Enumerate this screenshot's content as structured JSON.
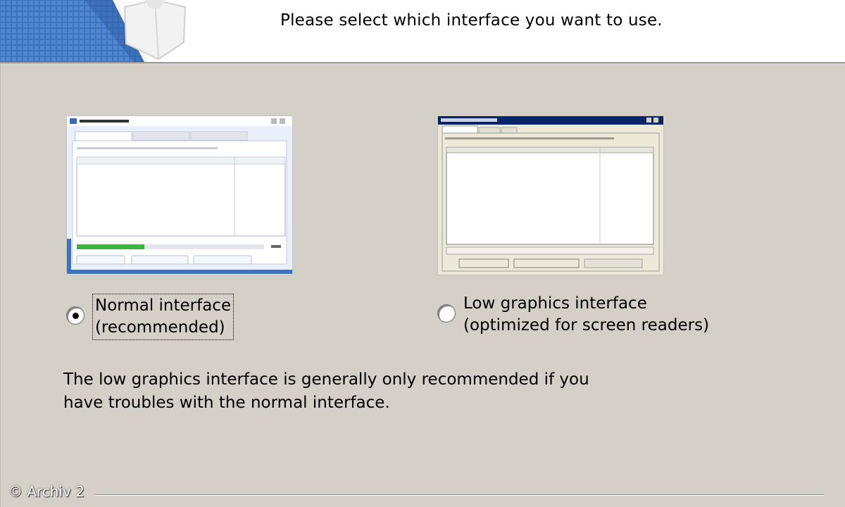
{
  "header": {
    "title": "Please select which interface you want to use."
  },
  "options": {
    "normal": {
      "line1": "Normal interface",
      "line2": "(recommended)",
      "selected": true
    },
    "low": {
      "line1": "Low graphics interface",
      "line2": "(optimized for screen readers)",
      "selected": false
    }
  },
  "note": {
    "line1": "The low graphics interface is generally only recommended if you",
    "line2": "have troubles with the normal interface."
  },
  "watermark": "© Archiv 2",
  "colors": {
    "dialog_bg": "#d4d0c8",
    "header_bg": "#ffffff",
    "banner_blue": "#3b6fb8",
    "progress_green": "#38b838"
  }
}
